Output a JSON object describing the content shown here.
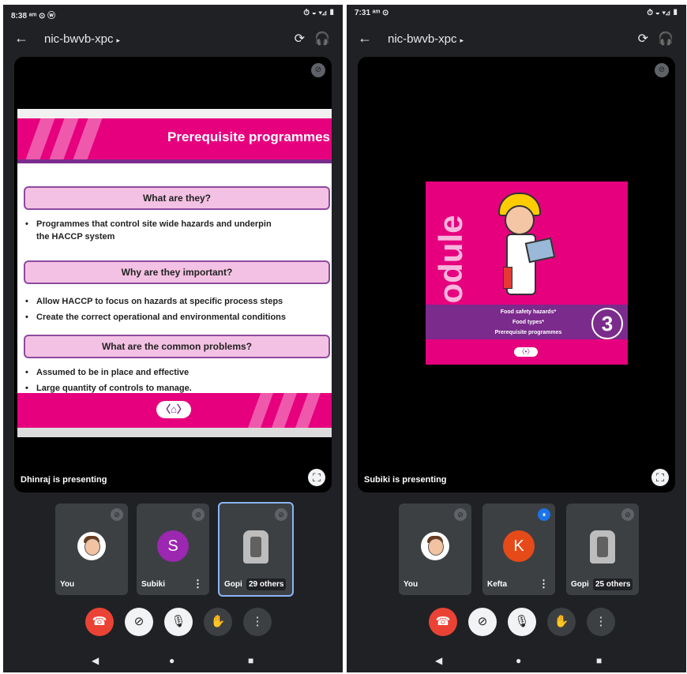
{
  "screens": [
    {
      "status": {
        "time": "8:38 ᵃᵐ ⊙ ⓦ",
        "icons": "⏱ ◒ ▾⊿ ▮"
      },
      "topbar": {
        "back_glyph": "←",
        "meeting_code": "nic-bwvb-xpc",
        "caret": "▸",
        "switch_camera_glyph": "⟳",
        "audio_glyph": "🎧"
      },
      "stage": {
        "presenting_label": "Dhinraj is presenting",
        "pin_glyph": "⊘",
        "fullscreen_glyph": "⛶",
        "slide": {
          "title": "Prerequisite programmes",
          "sections": [
            {
              "heading": "What are they?",
              "bullets": [
                "Programmes that control site wide hazards and underpin",
                "the HACCP system"
              ]
            },
            {
              "heading": "Why are they important?",
              "bullets": [
                "Allow HACCP to focus on hazards at specific process steps",
                "Create the correct operational and environmental conditions"
              ]
            },
            {
              "heading": "What are the common problems?",
              "bullets": [
                "Assumed to be in place and effective",
                "Large quantity of controls to manage."
              ]
            }
          ],
          "nav_glyph": "〈⌂〉"
        }
      },
      "tiles": [
        {
          "name": "You",
          "pin_glyph": "⊘"
        },
        {
          "name": "Subiki",
          "avatar_letter": "S",
          "avatar_color": "#9c27b0",
          "more_glyph": "⋮",
          "pin_glyph": "⊘"
        },
        {
          "name": "Gopi",
          "others": "29 others",
          "pin_glyph": "⊘"
        }
      ],
      "controls": {
        "end_glyph": "☎",
        "camera_glyph": "⊘",
        "mic_glyph": "🎙",
        "hand_glyph": "✋",
        "more_glyph": "⋮"
      },
      "nav": {
        "back": "◀",
        "home": "●",
        "recents": "■"
      }
    },
    {
      "status": {
        "time": "7:31 ᵃᵐ ⊙",
        "icons": "⏱ ◒ ▾⊿ ▮"
      },
      "topbar": {
        "back_glyph": "←",
        "meeting_code": "nic-bwvb-xpc",
        "caret": "▸",
        "switch_camera_glyph": "⟳",
        "audio_glyph": "🎧"
      },
      "stage": {
        "presenting_label": "Subiki is presenting",
        "pin_glyph": "⊘",
        "fullscreen_glyph": "⛶",
        "slide": {
          "module_word": "Module",
          "topics": [
            "Food safety hazards*",
            "Food types*",
            "Prerequisite programmes"
          ],
          "module_number": "3",
          "nav_glyph": "〈•〉"
        }
      },
      "tiles": [
        {
          "name": "You",
          "pin_glyph": "⊘"
        },
        {
          "name": "Kefta",
          "avatar_letter": "K",
          "avatar_color": "#e64a19",
          "more_glyph": "⋮",
          "speaking_glyph": "⏸"
        },
        {
          "name": "Gopi",
          "others": "25 others",
          "pin_glyph": "⊘"
        }
      ],
      "controls": {
        "end_glyph": "☎",
        "camera_glyph": "⊘",
        "mic_glyph": "🎙",
        "hand_glyph": "✋",
        "more_glyph": "⋮"
      },
      "nav": {
        "back": "◀",
        "home": "●",
        "recents": "■"
      }
    }
  ]
}
